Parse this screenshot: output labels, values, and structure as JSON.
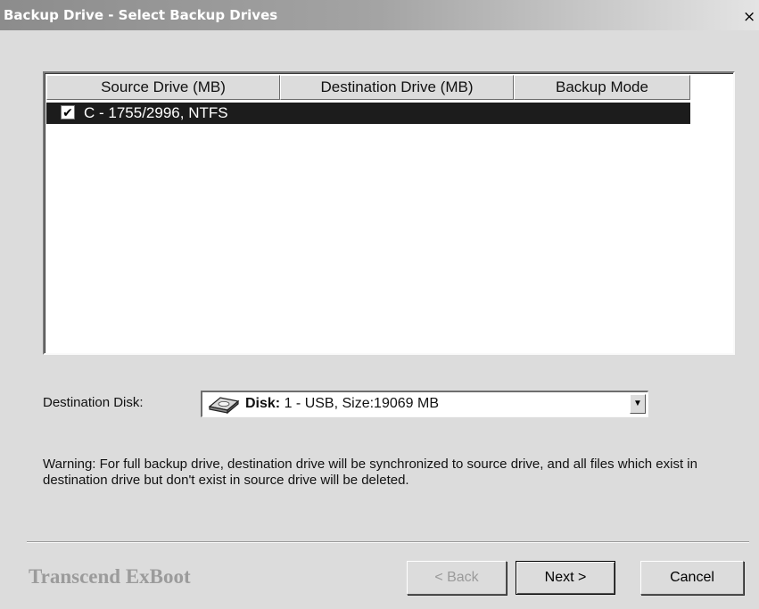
{
  "window": {
    "title": "Backup Drive - Select Backup Drives",
    "close_glyph": "×"
  },
  "list": {
    "columns": [
      "Source Drive (MB)",
      "Destination Drive (MB)",
      "Backup Mode"
    ],
    "rows": [
      {
        "checked": true,
        "checkmark": "✔",
        "label": "C - 1755/2996, NTFS",
        "selected": true
      }
    ]
  },
  "destination": {
    "label": "Destination Disk:",
    "icon": "hard-disk-icon",
    "value_bold": "Disk:",
    "value_rest": " 1 - USB, Size:19069 MB",
    "dropdown_glyph": "▼"
  },
  "warning": "Warning: For full backup drive, destination drive will be synchronized to source drive, and all files which exist in destination drive but don't exist in source drive will be deleted.",
  "footer": {
    "brand": "Transcend ExBoot",
    "buttons": {
      "back": "< Back",
      "next": "Next >",
      "cancel": "Cancel"
    }
  },
  "colors": {
    "selection": "#1c1c1c",
    "face": "#dcdcdc",
    "brand": "#9b9b9b"
  }
}
